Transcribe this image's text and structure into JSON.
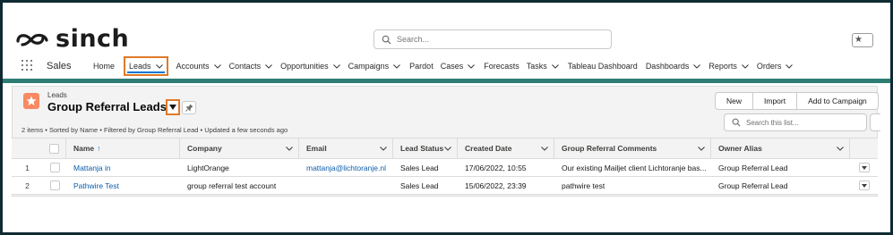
{
  "brand": {
    "name": "sinch"
  },
  "global_search": {
    "placeholder": "Search..."
  },
  "app": {
    "name": "Sales"
  },
  "nav": {
    "items": [
      {
        "label": "Home",
        "has_menu": false
      },
      {
        "label": "Leads",
        "has_menu": true,
        "active": true
      },
      {
        "label": "Accounts",
        "has_menu": true
      },
      {
        "label": "Contacts",
        "has_menu": true
      },
      {
        "label": "Opportunities",
        "has_menu": true
      },
      {
        "label": "Campaigns",
        "has_menu": true
      },
      {
        "label": "Pardot",
        "has_menu": false
      },
      {
        "label": "Cases",
        "has_menu": true
      },
      {
        "label": "Forecasts",
        "has_menu": false
      },
      {
        "label": "Tasks",
        "has_menu": true
      },
      {
        "label": "Tableau Dashboard",
        "has_menu": false
      },
      {
        "label": "Dashboards",
        "has_menu": true
      },
      {
        "label": "Reports",
        "has_menu": true
      },
      {
        "label": "Orders",
        "has_menu": true
      }
    ]
  },
  "list_view": {
    "object_label": "Leads",
    "title": "Group Referral Leads",
    "meta": "2 items • Sorted by Name • Filtered by Group Referral Lead • Updated a few seconds ago",
    "buttons": [
      "New",
      "Import",
      "Add to Campaign"
    ],
    "search_placeholder": "Search this list..."
  },
  "table": {
    "columns": [
      {
        "label": "Name",
        "sort": "↑"
      },
      {
        "label": "Company"
      },
      {
        "label": "Email"
      },
      {
        "label": "Lead Status"
      },
      {
        "label": "Created Date"
      },
      {
        "label": "Group Referral Comments"
      },
      {
        "label": "Owner Alias"
      }
    ],
    "rows": [
      {
        "num": "1",
        "name": "Mattanja in",
        "company": "LightOrange",
        "email": "mattanja@lichtoranje.nl",
        "status": "Sales Lead",
        "created": "17/06/2022, 10:55",
        "comments": "Our existing Mailjet client Lichtoranje bas...",
        "owner": "Group Referral Lead"
      },
      {
        "num": "2",
        "name": "Pathwire Test",
        "company": "group referral test account",
        "email": "",
        "status": "Sales Lead",
        "created": "15/06/2022, 23:39",
        "comments": "pathwire test",
        "owner": "Group Referral Lead"
      }
    ]
  },
  "colors": {
    "accent_orange": "#e07a2a",
    "nav_bar": "#2e7d74",
    "lead_icon": "#f88962",
    "link": "#0b5cab"
  }
}
